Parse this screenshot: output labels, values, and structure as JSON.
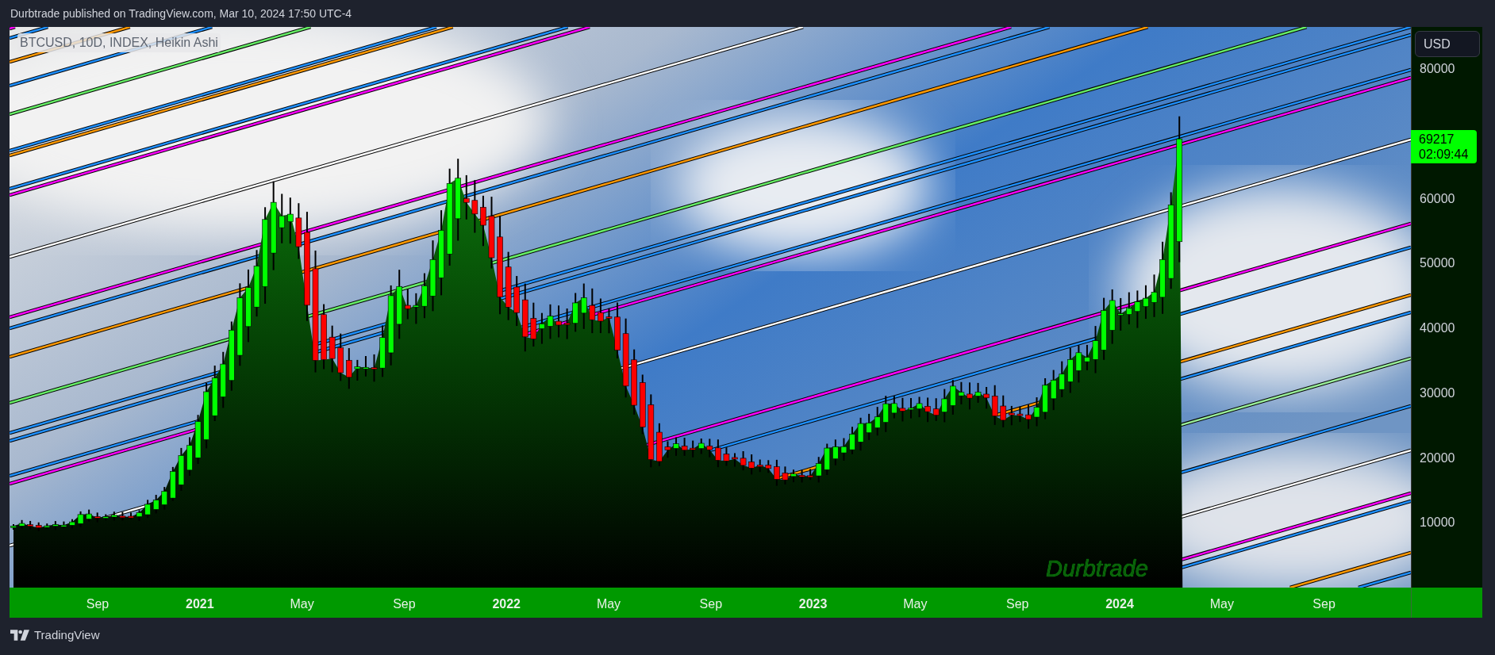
{
  "header": {
    "title": "Durbtrade published on TradingView.com, Mar 10, 2024 17:50 UTC-4"
  },
  "chart": {
    "legend": "BTCUSD, 10D, INDEX, Heikin Ashi",
    "signature": "Durbtrade"
  },
  "price_axis": {
    "currency": "USD",
    "labels": [
      "80000",
      "60000",
      "50000",
      "40000",
      "30000",
      "20000",
      "10000"
    ],
    "last_price": {
      "price": "69217",
      "countdown": "02:09:44"
    }
  },
  "time_axis": {
    "labels": [
      {
        "text": "Sep",
        "kind": "month"
      },
      {
        "text": "2021",
        "kind": "year"
      },
      {
        "text": "May",
        "kind": "month"
      },
      {
        "text": "Sep",
        "kind": "month"
      },
      {
        "text": "2022",
        "kind": "year"
      },
      {
        "text": "May",
        "kind": "month"
      },
      {
        "text": "Sep",
        "kind": "month"
      },
      {
        "text": "2023",
        "kind": "year"
      },
      {
        "text": "May",
        "kind": "month"
      },
      {
        "text": "Sep",
        "kind": "month"
      },
      {
        "text": "2024",
        "kind": "year"
      },
      {
        "text": "May",
        "kind": "month"
      },
      {
        "text": "Sep",
        "kind": "month"
      }
    ]
  },
  "footer": {
    "brand": "TradingView"
  }
}
